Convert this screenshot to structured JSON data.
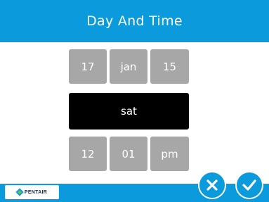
{
  "header": {
    "title": "Day And Time"
  },
  "date": {
    "day": "17",
    "month": "jan",
    "year": "15"
  },
  "weekday": "sat",
  "time": {
    "hour": "12",
    "minute": "01",
    "ampm": "pm"
  },
  "footer": {
    "logo_text": "PENTAIR"
  },
  "buttons": {
    "cancel_icon": "close-icon",
    "confirm_icon": "checkmark-icon"
  },
  "colors": {
    "accent": "#0b9bdc",
    "cell": "#a7a7a7",
    "selected": "#000000"
  }
}
